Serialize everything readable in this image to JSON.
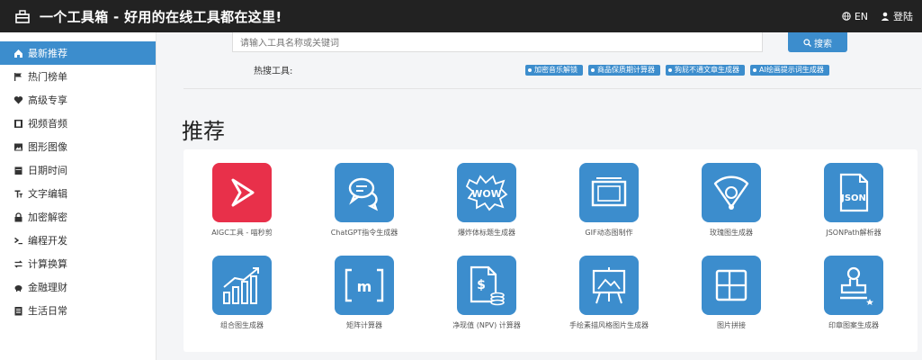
{
  "header": {
    "title": "一个工具箱 - 好用的在线工具都在这里!",
    "lang": "EN",
    "login": "登陆"
  },
  "sidebar": {
    "items": [
      {
        "label": "最新推荐",
        "icon": "home-icon"
      },
      {
        "label": "热门榜单",
        "icon": "flag-icon"
      },
      {
        "label": "高级专享",
        "icon": "heart-icon"
      },
      {
        "label": "视频音频",
        "icon": "film-icon"
      },
      {
        "label": "图形图像",
        "icon": "image-icon"
      },
      {
        "label": "日期时间",
        "icon": "calendar-icon"
      },
      {
        "label": "文字编辑",
        "icon": "text-icon"
      },
      {
        "label": "加密解密",
        "icon": "lock-icon"
      },
      {
        "label": "编程开发",
        "icon": "terminal-icon"
      },
      {
        "label": "计算换算",
        "icon": "exchange-icon"
      },
      {
        "label": "金融理财",
        "icon": "piggy-bank-icon"
      },
      {
        "label": "生活日常",
        "icon": "list-icon"
      }
    ]
  },
  "search": {
    "placeholder": "请输入工具名称或关键词",
    "button_label": "搜索"
  },
  "hot": {
    "label": "热搜工具:",
    "tags": [
      "加密音乐解锁",
      "商品保质期计算器",
      "狗屁不通文章生成器",
      "AI绘画提示词生成器"
    ]
  },
  "section": {
    "title": "推荐"
  },
  "tools": [
    {
      "name": "AIGC工具 - 喵秒剪",
      "icon": "play-logo-icon"
    },
    {
      "name": "ChatGPT指令生成器",
      "icon": "chat-bubbles-icon"
    },
    {
      "name": "爆炸体标题生成器",
      "icon": "wow-icon"
    },
    {
      "name": "GIF动态图制作",
      "icon": "film-frame-icon"
    },
    {
      "name": "玫瑰图生成器",
      "icon": "fan-chart-icon"
    },
    {
      "name": "JSONPath解析器",
      "icon": "json-file-icon"
    },
    {
      "name": "组合图生成器",
      "icon": "bar-chart-icon"
    },
    {
      "name": "矩阵计算器",
      "icon": "matrix-icon"
    },
    {
      "name": "净现值 (NPV) 计算器",
      "icon": "dollar-doc-icon"
    },
    {
      "name": "手绘素描风格图片生成器",
      "icon": "easel-icon"
    },
    {
      "name": "图片拼接",
      "icon": "grid-layout-icon"
    },
    {
      "name": "印章图案生成器",
      "icon": "stamp-icon"
    }
  ],
  "colors": {
    "accent": "#3c8dcd",
    "topbar": "#222222",
    "red": "#e8304a"
  }
}
